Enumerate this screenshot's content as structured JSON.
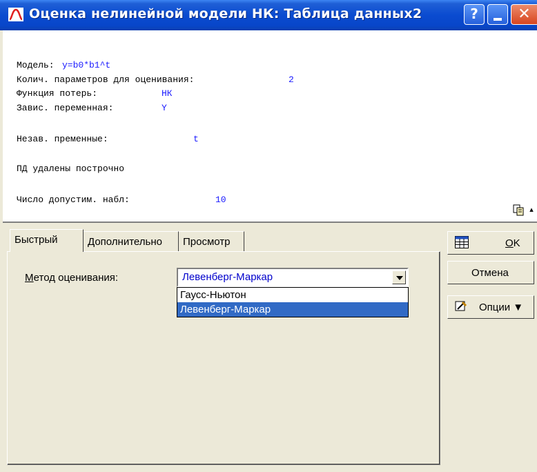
{
  "window": {
    "title": "Оценка нелинейной модели НК: Таблица данных2",
    "help_glyph": "?",
    "close_glyph": "✕"
  },
  "log": {
    "model_label": "Модель:",
    "model_value": "y=b0*b1^t",
    "param_count_label": "Колич. параметров для оценивания:",
    "param_count_value": "2",
    "loss_label": "Функция потерь:",
    "loss_value": "НК",
    "dep_var_label": "Завис. переменная:",
    "dep_var_value": "Y",
    "indep_var_label": "Незав. пременные:",
    "indep_var_value": "t",
    "missing_data": "ПД удалены построчно",
    "valid_obs_label": "Число допустим. набл:",
    "valid_obs_value": "10",
    "scroll_glyph": "▴"
  },
  "tabs": [
    {
      "label": "Быстрый"
    },
    {
      "label": "Дополнительно"
    },
    {
      "label": "Просмотр"
    }
  ],
  "method": {
    "label_underlined": "М",
    "label_rest": "етод оценивания:",
    "selected": "Левенберг-Маркар",
    "options": [
      "Гаусс-Ньютон",
      "Левенберг-Маркар"
    ]
  },
  "buttons": {
    "ok_underlined": "O",
    "ok_rest": "K",
    "cancel": "Отмена",
    "options": "Опции ▼"
  },
  "colors": {
    "titlebar": "#0a4bd0",
    "value_text": "#1a1aff",
    "selection": "#316ac5",
    "dialog_bg": "#ece9d8"
  }
}
